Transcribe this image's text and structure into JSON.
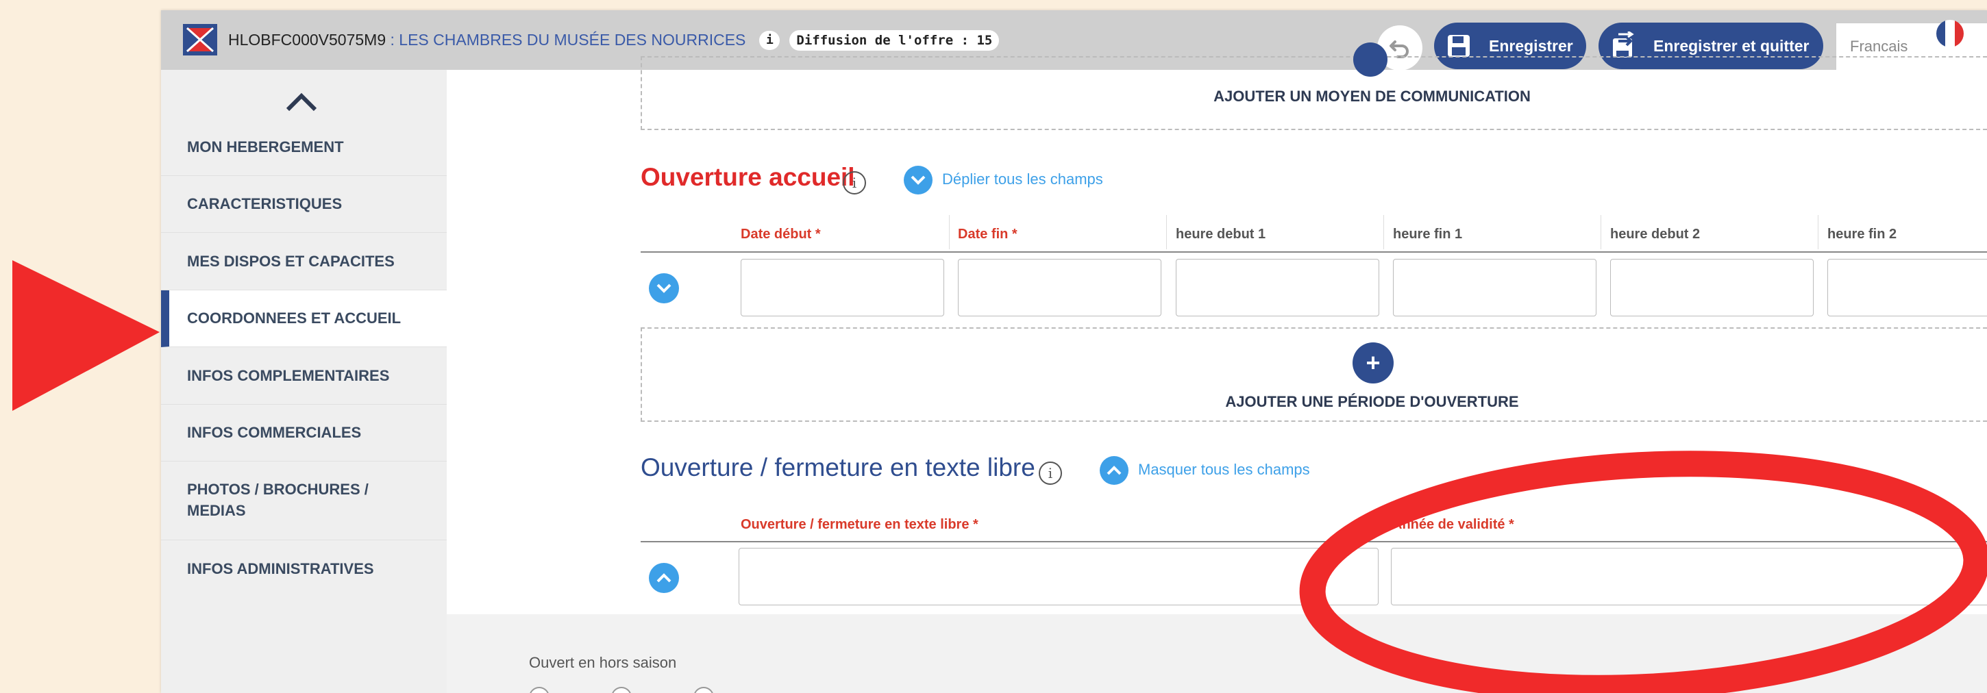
{
  "header": {
    "offer_code": "HLOBFC000V5075M9",
    "separator": " : ",
    "offer_name": "LES CHAMBRES DU MUSÉE DES NOURRICES",
    "info_label": "i",
    "diffusion": "Diffusion de l'offre : 15",
    "save_label": "Enregistrer",
    "save_quit_label": "Enregistrer et quitter",
    "language": "Francais",
    "colors": {
      "bar": "#cfcfcf",
      "primary": "#2f4d8f"
    }
  },
  "sidebar": {
    "items": [
      {
        "label": "MON HEBERGEMENT"
      },
      {
        "label": "CARACTERISTIQUES"
      },
      {
        "label": "MES DISPOS ET CAPACITES"
      },
      {
        "label": "COORDONNEES ET ACCUEIL",
        "active": true
      },
      {
        "label": "INFOS COMPLEMENTAIRES"
      },
      {
        "label": "INFOS COMMERCIALES"
      },
      {
        "label": "PHOTOS / BROCHURES / MEDIAS"
      },
      {
        "label": "INFOS ADMINISTRATIVES"
      }
    ]
  },
  "main": {
    "add_communication_label": "AJOUTER UN MOYEN DE COMMUNICATION",
    "ouverture_accueil": {
      "title": "Ouverture accueil",
      "toggle_label": "Déplier tous les champs",
      "columns": [
        "Date début *",
        "Date fin *",
        "heure debut 1",
        "heure fin 1",
        "heure debut 2",
        "heure fin 2"
      ],
      "values": [
        "",
        "",
        "",
        "",
        "",
        ""
      ],
      "add_period_label": "AJOUTER UNE PÉRIODE D'OUVERTURE"
    },
    "texte_libre": {
      "title": "Ouverture / fermeture en texte libre",
      "toggle_label": "Masquer tous les champs",
      "col_text": "Ouverture / fermeture en texte libre *",
      "col_year": "Année de validité *",
      "text_value": "",
      "year_value": "",
      "panel_label": "Ouvert en hors saison"
    }
  },
  "annotation_color": "#f02a2a"
}
